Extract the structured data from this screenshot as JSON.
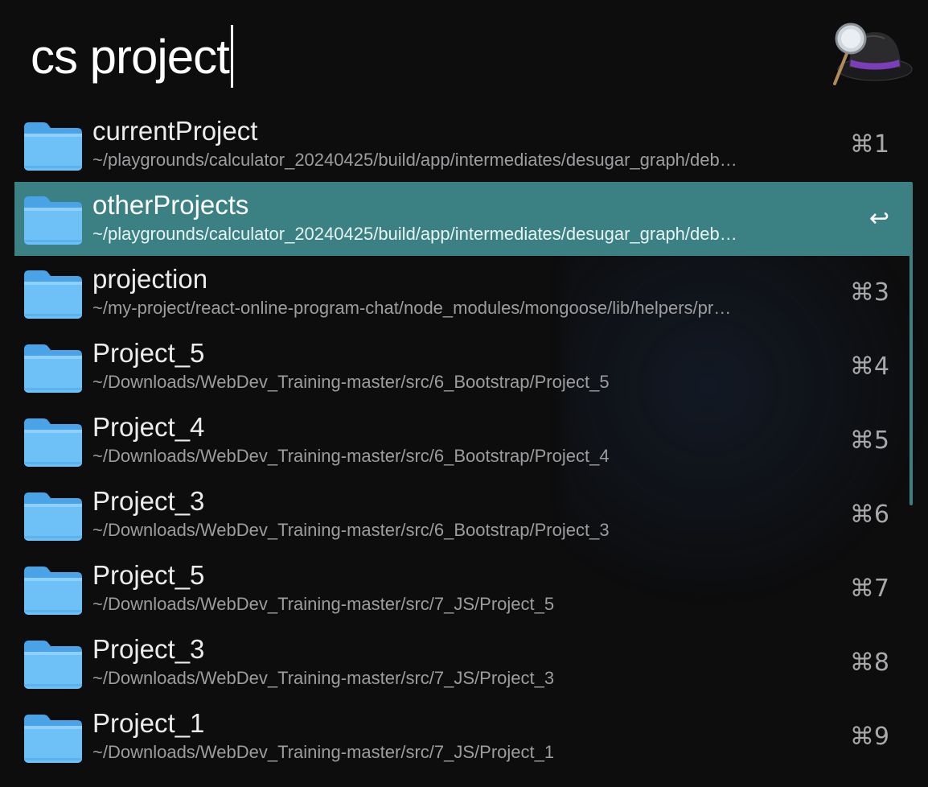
{
  "search": {
    "query": "cs project"
  },
  "icons": {
    "app": "alfred-hat-icon",
    "folder": "folder-icon"
  },
  "colors": {
    "selection": "#3b8083",
    "folder_front": "#6ec1f7",
    "folder_back": "#4aa3e6"
  },
  "results": [
    {
      "title": "currentProject",
      "path": "~/playgrounds/calculator_20240425/build/app/intermediates/desugar_graph/deb…",
      "shortcut": "⌘1",
      "selected": false
    },
    {
      "title": "otherProjects",
      "path": "~/playgrounds/calculator_20240425/build/app/intermediates/desugar_graph/deb…",
      "shortcut": "↩",
      "selected": true
    },
    {
      "title": "projection",
      "path": "~/my-project/react-online-program-chat/node_modules/mongoose/lib/helpers/pr…",
      "shortcut": "⌘3",
      "selected": false
    },
    {
      "title": "Project_5",
      "path": "~/Downloads/WebDev_Training-master/src/6_Bootstrap/Project_5",
      "shortcut": "⌘4",
      "selected": false
    },
    {
      "title": "Project_4",
      "path": "~/Downloads/WebDev_Training-master/src/6_Bootstrap/Project_4",
      "shortcut": "⌘5",
      "selected": false
    },
    {
      "title": "Project_3",
      "path": "~/Downloads/WebDev_Training-master/src/6_Bootstrap/Project_3",
      "shortcut": "⌘6",
      "selected": false
    },
    {
      "title": "Project_5",
      "path": "~/Downloads/WebDev_Training-master/src/7_JS/Project_5",
      "shortcut": "⌘7",
      "selected": false
    },
    {
      "title": "Project_3",
      "path": "~/Downloads/WebDev_Training-master/src/7_JS/Project_3",
      "shortcut": "⌘8",
      "selected": false
    },
    {
      "title": "Project_1",
      "path": "~/Downloads/WebDev_Training-master/src/7_JS/Project_1",
      "shortcut": "⌘9",
      "selected": false
    }
  ]
}
